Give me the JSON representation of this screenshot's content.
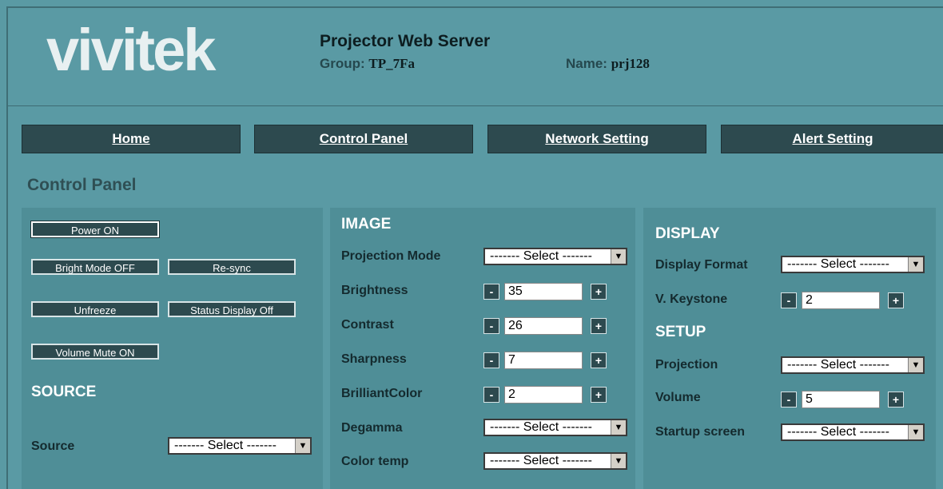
{
  "header": {
    "logo": "vivitek",
    "title": "Projector Web Server",
    "group_label": "Group:",
    "group_value": "TP_7Fa",
    "name_label": "Name:",
    "name_value": "prj128"
  },
  "nav": [
    "Home",
    "Control Panel",
    "Network Setting",
    "Alert Setting"
  ],
  "page_title": "Control Panel",
  "left": {
    "power": "Power ON",
    "bright_mode": "Bright Mode OFF",
    "resync": "Re-sync",
    "unfreeze": "Unfreeze",
    "status_display": "Status Display Off",
    "volume_mute": "Volume Mute ON",
    "source_heading": "SOURCE",
    "source_label": "Source",
    "source_select": "------- Select -------"
  },
  "image": {
    "heading": "IMAGE",
    "projection_mode_label": "Projection Mode",
    "projection_mode_select": "------- Select -------",
    "brightness_label": "Brightness",
    "brightness_value": "35",
    "contrast_label": "Contrast",
    "contrast_value": "26",
    "sharpness_label": "Sharpness",
    "sharpness_value": "7",
    "brilliantcolor_label": "BrilliantColor",
    "brilliantcolor_value": "2",
    "degamma_label": "Degamma",
    "degamma_select": "------- Select -------",
    "colortemp_label": "Color temp",
    "colortemp_select": "------- Select -------"
  },
  "display": {
    "heading": "DISPLAY",
    "format_label": "Display Format",
    "format_select": "------- Select -------",
    "keystone_label": "V. Keystone",
    "keystone_value": "2",
    "setup_heading": "SETUP",
    "projection_label": "Projection",
    "projection_select": "------- Select -------",
    "volume_label": "Volume",
    "volume_value": "5",
    "startup_label": "Startup screen",
    "startup_select": "------- Select -------"
  },
  "controls": {
    "minus": "-",
    "plus": "+",
    "dropdown": "▼"
  },
  "colors": {
    "background": "#5a9aa4",
    "panel": "#4f8e97",
    "nav": "#2d4a4f"
  }
}
